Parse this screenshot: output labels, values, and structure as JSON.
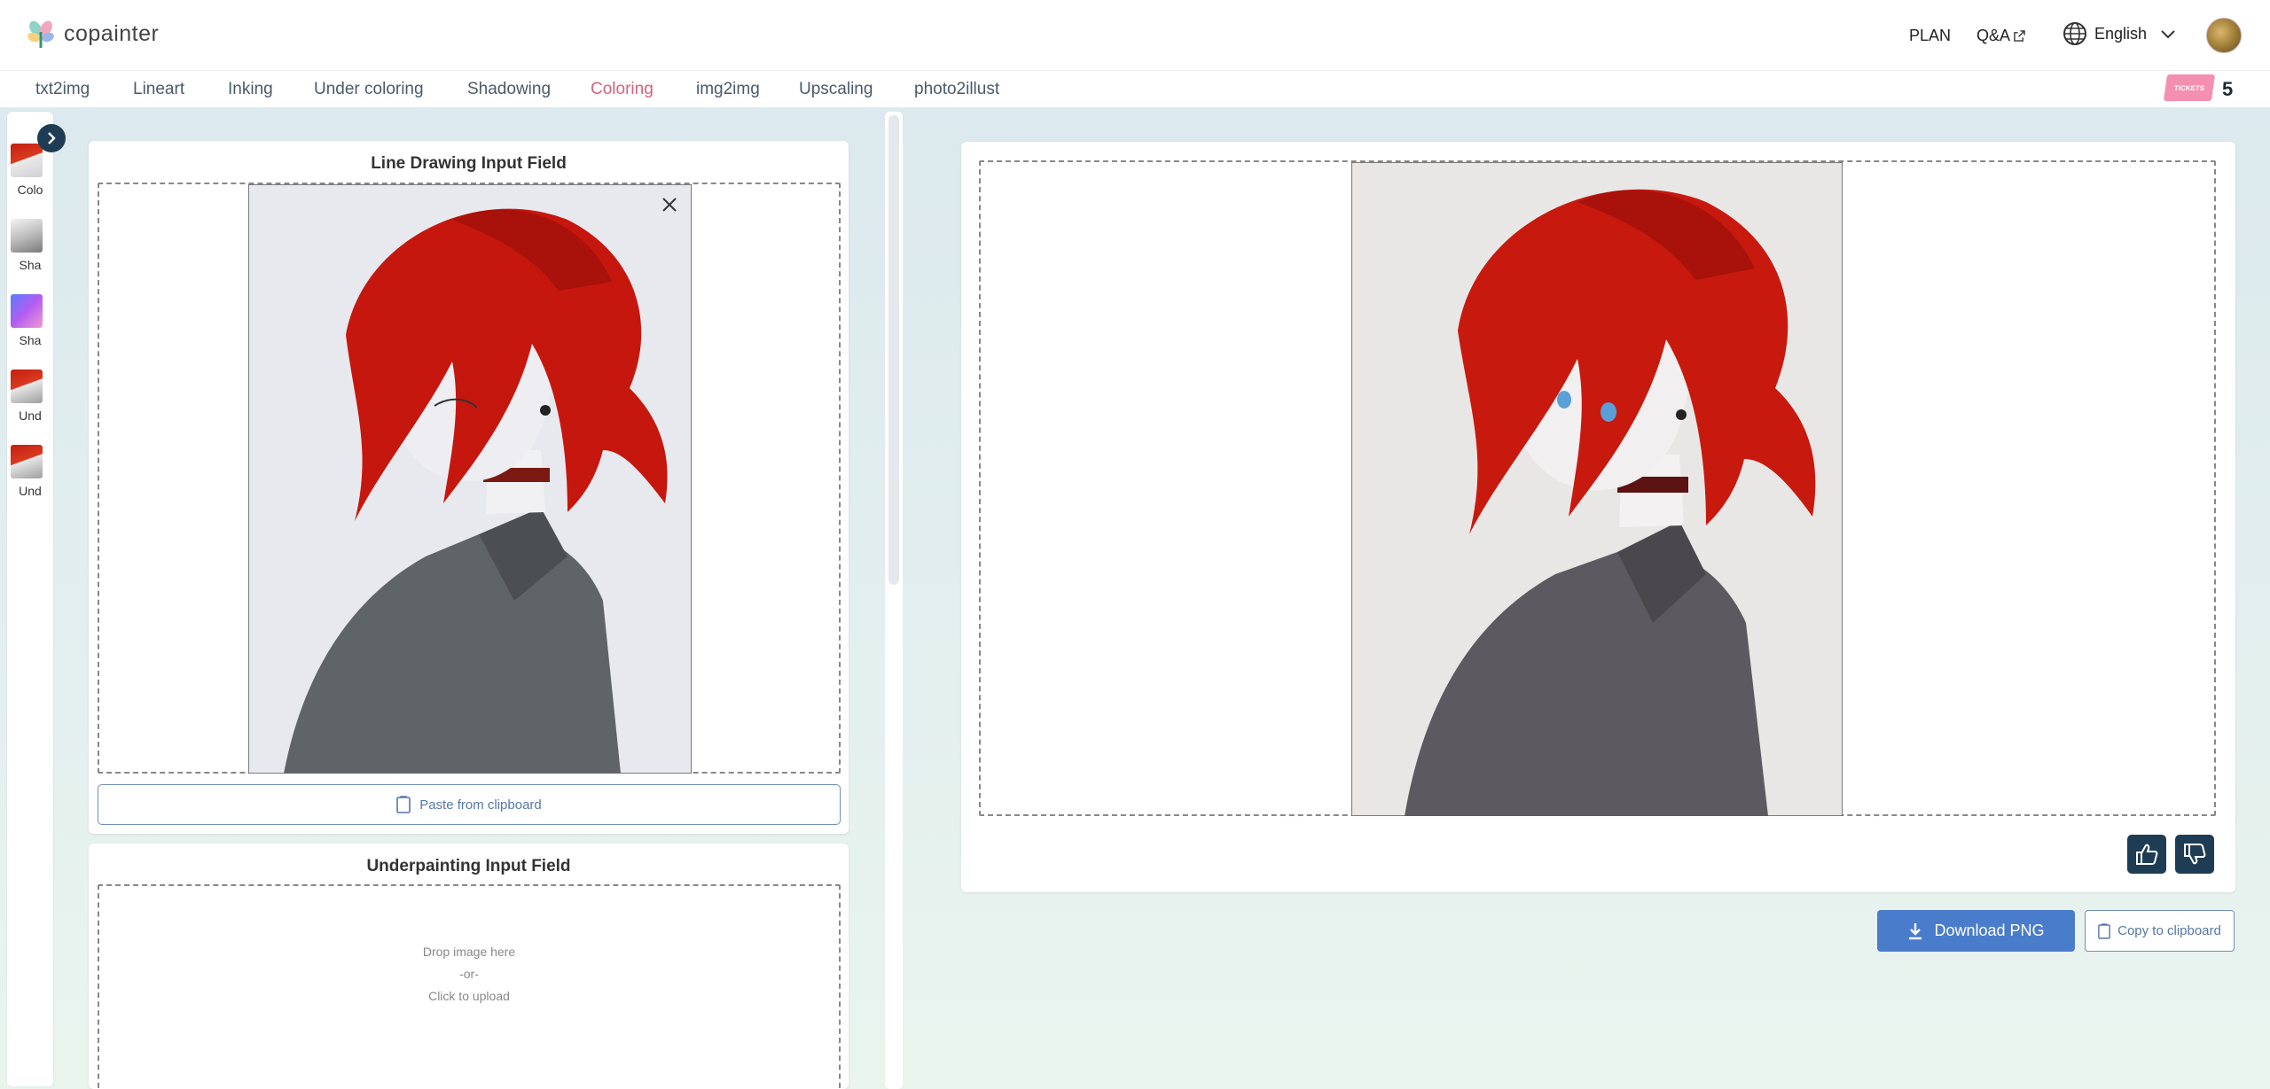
{
  "app": {
    "logo_text": "copainter",
    "brand_colors": {
      "accent": "#d9607b",
      "primary": "#4a7ccc",
      "dark": "#1f3c55"
    }
  },
  "header": {
    "plan_label": "PLAN",
    "qa_label": "Q&A",
    "language_label": "English"
  },
  "tabs": [
    {
      "label": "txt2img"
    },
    {
      "label": "Lineart"
    },
    {
      "label": "Inking"
    },
    {
      "label": "Under coloring"
    },
    {
      "label": "Shadowing"
    },
    {
      "label": "Coloring",
      "active": true
    },
    {
      "label": "img2img"
    },
    {
      "label": "Upscaling"
    },
    {
      "label": "photo2illust"
    }
  ],
  "tickets": {
    "label": "TICKETS",
    "count": "5"
  },
  "history": [
    {
      "label": "Colo",
      "thumb": "red-hair-color"
    },
    {
      "label": "Sha",
      "thumb": "sketch-gray"
    },
    {
      "label": "Sha",
      "thumb": "gradient-purple"
    },
    {
      "label": "Und",
      "thumb": "red-hair-under"
    },
    {
      "label": "Und",
      "thumb": "red-hair-under"
    }
  ],
  "line_panel": {
    "title": "Line Drawing Input Field",
    "paste_label": "Paste from clipboard"
  },
  "under_panel": {
    "title": "Underpainting Input Field",
    "drop_text": "Drop image here",
    "or_text": "-or-",
    "upload_text": "Click to upload"
  },
  "output": {
    "download_label": "Download PNG",
    "copy_label": "Copy to clipboard"
  },
  "icons": {
    "close": "close-icon",
    "clipboard": "clipboard-icon",
    "thumbs_up": "thumbs-up-icon",
    "thumbs_down": "thumbs-down-icon",
    "download": "download-icon",
    "globe": "globe-icon",
    "external": "external-link-icon"
  }
}
